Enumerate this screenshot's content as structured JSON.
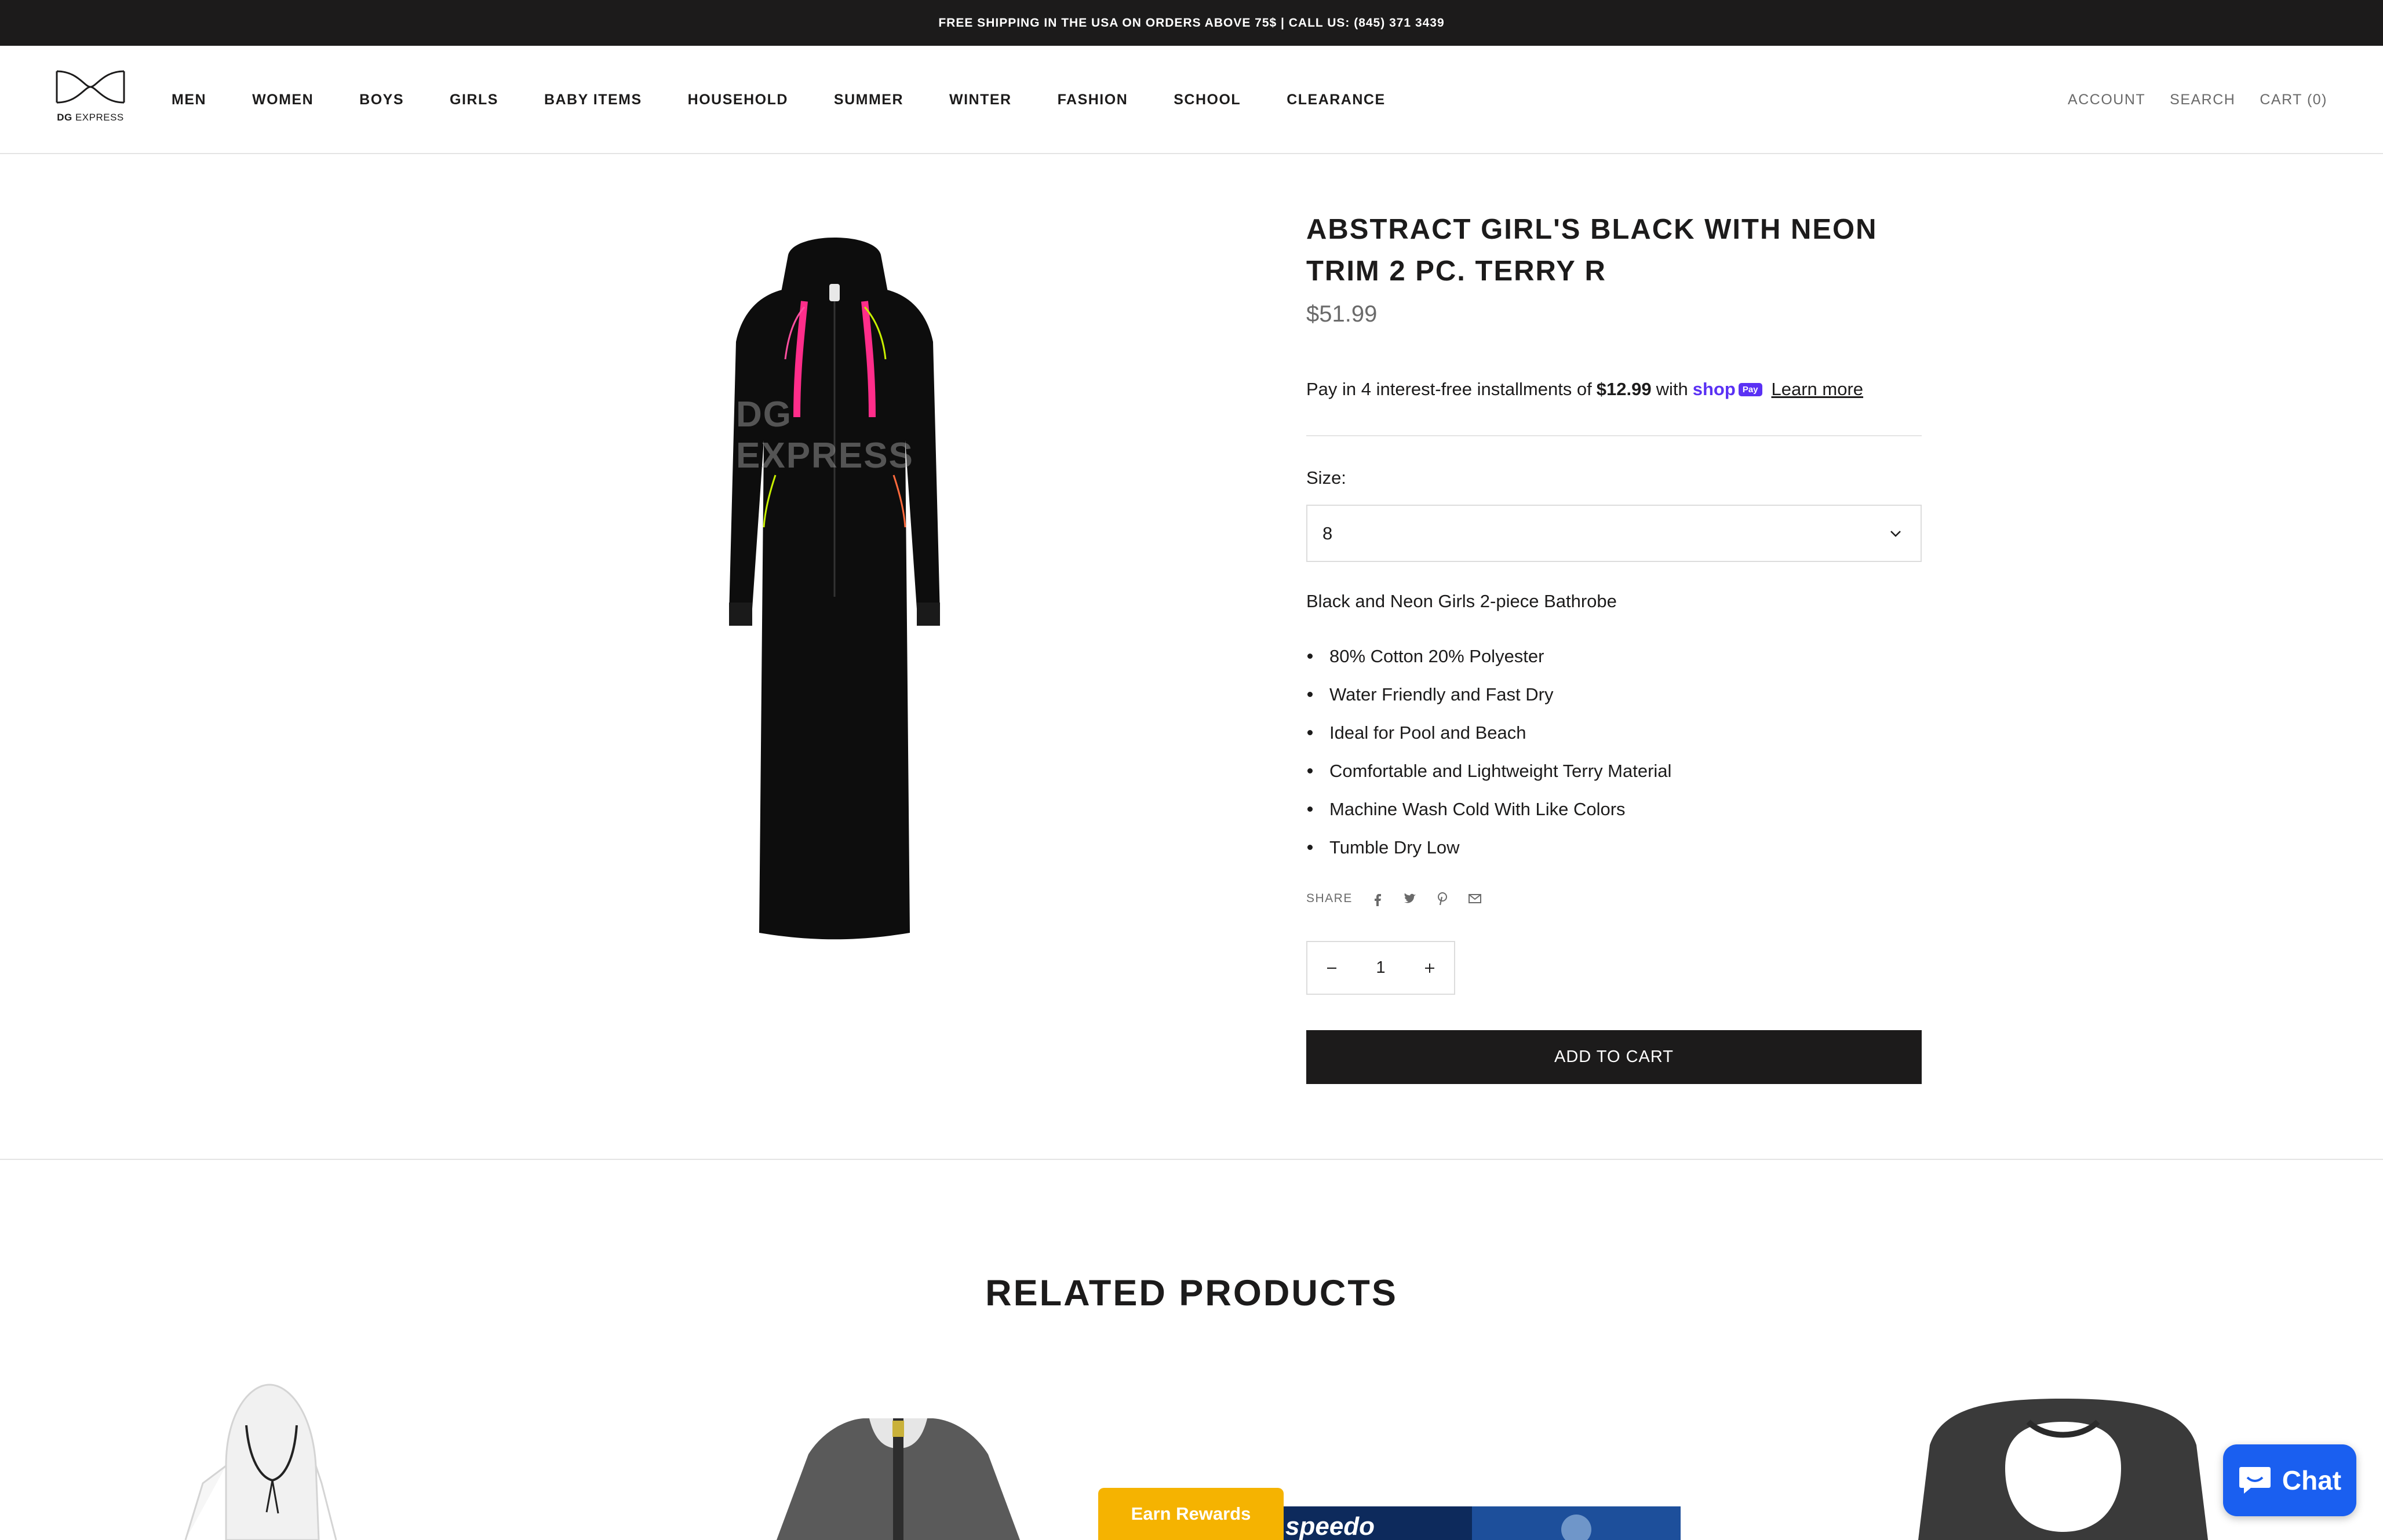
{
  "announcement": "FREE SHIPPING IN THE USA ON ORDERS ABOVE 75$ | CALL US: (845) 371 3439",
  "logo": {
    "bold": "DG",
    "rest": " EXPRESS"
  },
  "nav": [
    "MEN",
    "WOMEN",
    "BOYS",
    "GIRLS",
    "BABY ITEMS",
    "HOUSEHOLD",
    "SUMMER",
    "WINTER",
    "FASHION",
    "SCHOOL",
    "CLEARANCE"
  ],
  "secondary_nav": {
    "account": "ACCOUNT",
    "search": "SEARCH",
    "cart": "CART (0)"
  },
  "product": {
    "watermark": "DG EXPRESS",
    "title": "ABSTRACT GIRL'S BLACK WITH NEON TRIM 2 PC. TERRY R",
    "price": "$51.99",
    "installments_prefix": "Pay in 4 interest-free installments of",
    "installment_amount": "$12.99",
    "installments_with": "with",
    "shop_pay_word": "shop",
    "shop_pay_badge": "Pay",
    "learn_more": "Learn more",
    "size_label": "Size:",
    "size_value": "8",
    "description": "Black and Neon Girls 2-piece Bathrobe",
    "features": [
      "80% Cotton 20% Polyester",
      "Water Friendly and Fast Dry",
      "Ideal for Pool and Beach",
      "Comfortable and Lightweight Terry Material",
      "Machine Wash Cold With Like Colors",
      "Tumble Dry Low"
    ],
    "share_label": "SHARE",
    "quantity": "1",
    "add_to_cart": "ADD TO CART"
  },
  "related": {
    "title": "RELATED PRODUCTS",
    "brand_text": "speedo"
  },
  "rewards_label": "Earn Rewards",
  "chat_label": "Chat",
  "colors": {
    "dark": "#1c1b1b",
    "muted": "#6a6a6a",
    "accent_pink": "#ff2d8a",
    "accent_neon": "#c8f000",
    "shop_pay": "#5a31f4",
    "chat": "#1a5ff0",
    "rewards": "#f5b301"
  },
  "icons": [
    "facebook-icon",
    "twitter-icon",
    "pinterest-icon",
    "email-icon",
    "chevron-down-icon",
    "minus-icon",
    "plus-icon",
    "chat-bubble-icon"
  ]
}
